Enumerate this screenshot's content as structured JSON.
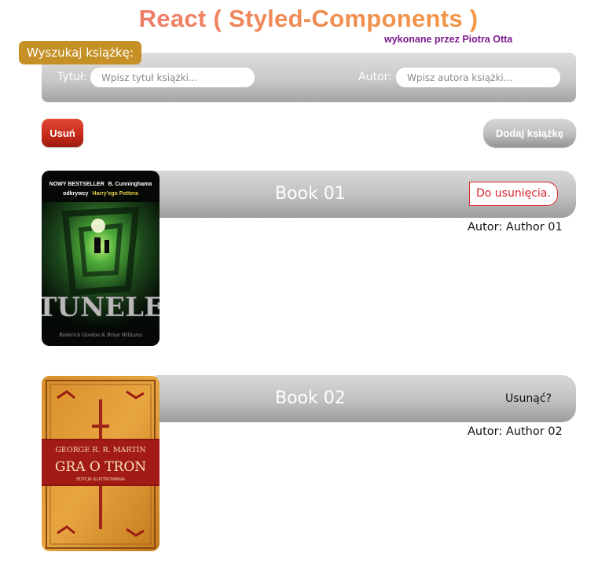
{
  "header": {
    "title": "React ( Styled-Components )",
    "credit": "wykonane przez Piotra Otta"
  },
  "search": {
    "badge": "Wyszukaj książkę:",
    "title_label": "Tytuł:",
    "title_placeholder": "Wpisz tytuł książki...",
    "title_value": "",
    "author_label": "Autor:",
    "author_placeholder": "Wpisz autora książki...",
    "author_value": ""
  },
  "actions": {
    "remove_label": "Usuń",
    "add_label": "Dodaj książkę"
  },
  "books": [
    {
      "title": "Book 01",
      "author_line": "Autor: Author 01",
      "status": "Do usunięcia.",
      "cover": {
        "top_line": "NOWY BESTSELLER",
        "top_author": "B. Cunninghama",
        "subtitle_a": "odkrywcy",
        "subtitle_b": "Harry'ego Pottera",
        "title": "TUNELE",
        "authors": "Roderick Gordon & Brian Williams"
      }
    },
    {
      "title": "Book 02",
      "author_line": "Autor: Author 02",
      "status": "Usunąć?",
      "cover": {
        "author": "GEORGE R. R. MARTIN",
        "title": "GRA O TRON",
        "edition": "EDYCJA ILUSTROWANA"
      }
    }
  ],
  "colors": {
    "title_gradient": [
      "#ec6f7c",
      "#f2a13a"
    ],
    "credit": "#7b1a8c",
    "badge": "#c59126",
    "remove_button": "#c4291b",
    "marked_status": "#d9232a"
  }
}
